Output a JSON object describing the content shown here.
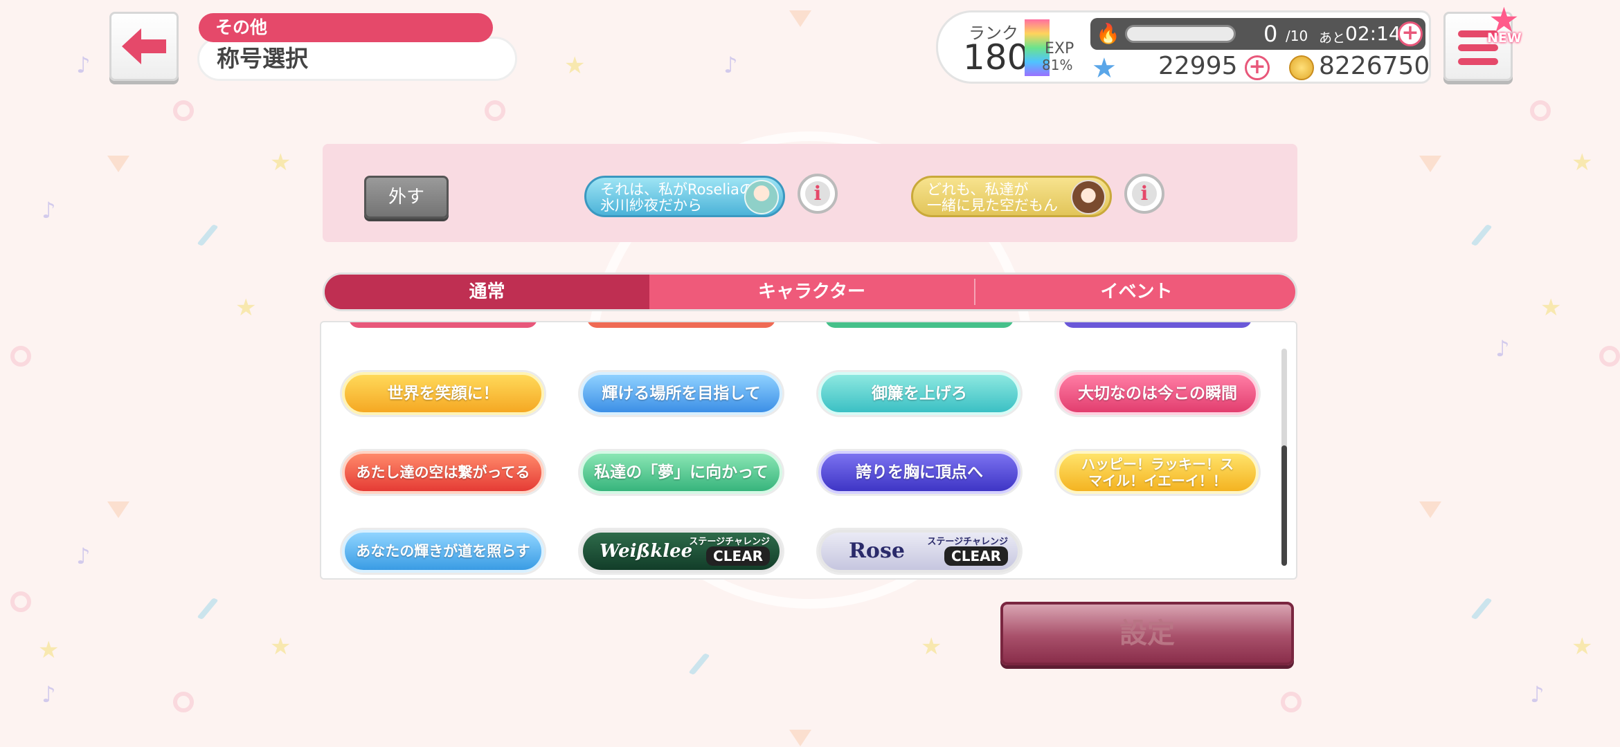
{
  "header": {
    "category": "その他",
    "title": "称号選択"
  },
  "status": {
    "rank_label": "ランク",
    "rank": "180",
    "exp_label": "EXP",
    "exp_percent": "81%",
    "stamina_current": "0",
    "stamina_max": "/10",
    "stamina_timer_label": "あと",
    "stamina_timer": "02:14",
    "star_gems": "22995",
    "coins": "8226750"
  },
  "menu": {
    "new_label": "NEW"
  },
  "equipped": {
    "remove_label": "外す",
    "slot1_line1": "それは、私がRoseliaの",
    "slot1_line2": "氷川紗夜だから",
    "slot2_line1": "どれも、私達が",
    "slot2_line2": "一緒に見た空だもん",
    "info_glyph": "i"
  },
  "tabs": [
    "通常",
    "キャラクター",
    "イベント"
  ],
  "titles": {
    "row1": [
      "世界を笑顔に！",
      "輝ける場所を目指して",
      "御簾を上げろ",
      "大切なのは今この瞬間"
    ],
    "row2": [
      "あたし達の空は繋がってる",
      "私達の「夢」に向かって",
      "誇りを胸に頂点へ",
      "ハッピー！ラッキー！スマイル！イエーイ！！"
    ],
    "row3": [
      "あなたの輝きが道を照らす",
      "Weißklee",
      "Rose"
    ],
    "stage_challenge": "ステージチャレンジ",
    "clear": "CLEAR"
  },
  "set_button": "設定",
  "colors": {
    "accent": "#e5496a",
    "tab_active": "#bf2f52",
    "set_button": "#8a2e4b"
  }
}
